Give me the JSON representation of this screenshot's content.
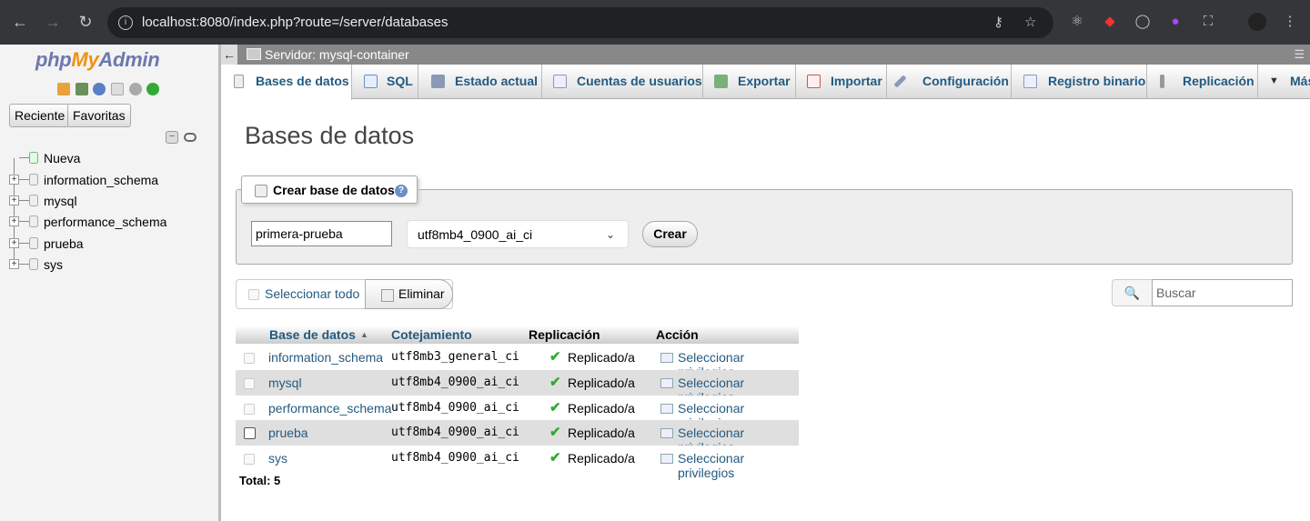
{
  "browser": {
    "url": "localhost:8080/index.php?route=/server/databases"
  },
  "sidebar": {
    "logo": {
      "php": "php",
      "my": "My",
      "admin": "Admin"
    },
    "buttons": {
      "recent": "Reciente",
      "favorites": "Favoritas"
    },
    "tree": [
      {
        "name": "Nueva",
        "icon": "new-db-icon"
      },
      {
        "name": "information_schema",
        "icon": "database-icon"
      },
      {
        "name": "mysql",
        "icon": "database-icon"
      },
      {
        "name": "performance_schema",
        "icon": "database-icon"
      },
      {
        "name": "prueba",
        "icon": "database-icon"
      },
      {
        "name": "sys",
        "icon": "database-icon"
      }
    ]
  },
  "server_bar": {
    "label": "Servidor: mysql-container"
  },
  "tabs": [
    {
      "label": "Bases de datos",
      "icon": "database-icon",
      "active": true
    },
    {
      "label": "SQL",
      "icon": "sql-icon"
    },
    {
      "label": "Estado actual",
      "icon": "status-icon"
    },
    {
      "label": "Cuentas de usuarios",
      "icon": "users-icon"
    },
    {
      "label": "Exportar",
      "icon": "export-icon"
    },
    {
      "label": "Importar",
      "icon": "import-icon"
    },
    {
      "label": "Configuración",
      "icon": "wrench-icon"
    },
    {
      "label": "Registro binario",
      "icon": "binlog-icon"
    },
    {
      "label": "Replicación",
      "icon": "replication-icon"
    },
    {
      "label": "Más",
      "icon": "caret-down-icon"
    }
  ],
  "main": {
    "title": "Bases de datos",
    "create": {
      "legend": "Crear base de datos",
      "name_value": "primera-prueba",
      "collation_value": "utf8mb4_0900_ai_ci",
      "button": "Crear"
    },
    "select_all": "Seleccionar todo",
    "delete": "Eliminar",
    "search_placeholder": "Buscar",
    "table": {
      "headers": {
        "db": "Base de datos",
        "collation": "Cotejamiento",
        "replication": "Replicación principal",
        "action": "Acción"
      },
      "rows": [
        {
          "db": "information_schema",
          "collation": "utf8mb3_general_ci",
          "replication": "Replicado/a",
          "action": "Seleccionar privilegios"
        },
        {
          "db": "mysql",
          "collation": "utf8mb4_0900_ai_ci",
          "replication": "Replicado/a",
          "action": "Seleccionar privilegios"
        },
        {
          "db": "performance_schema",
          "collation": "utf8mb4_0900_ai_ci",
          "replication": "Replicado/a",
          "action": "Seleccionar privilegios"
        },
        {
          "db": "prueba",
          "collation": "utf8mb4_0900_ai_ci",
          "replication": "Replicado/a",
          "action": "Seleccionar privilegios"
        },
        {
          "db": "sys",
          "collation": "utf8mb4_0900_ai_ci",
          "replication": "Replicado/a",
          "action": "Seleccionar privilegios"
        }
      ],
      "total": "Total: 5"
    }
  }
}
